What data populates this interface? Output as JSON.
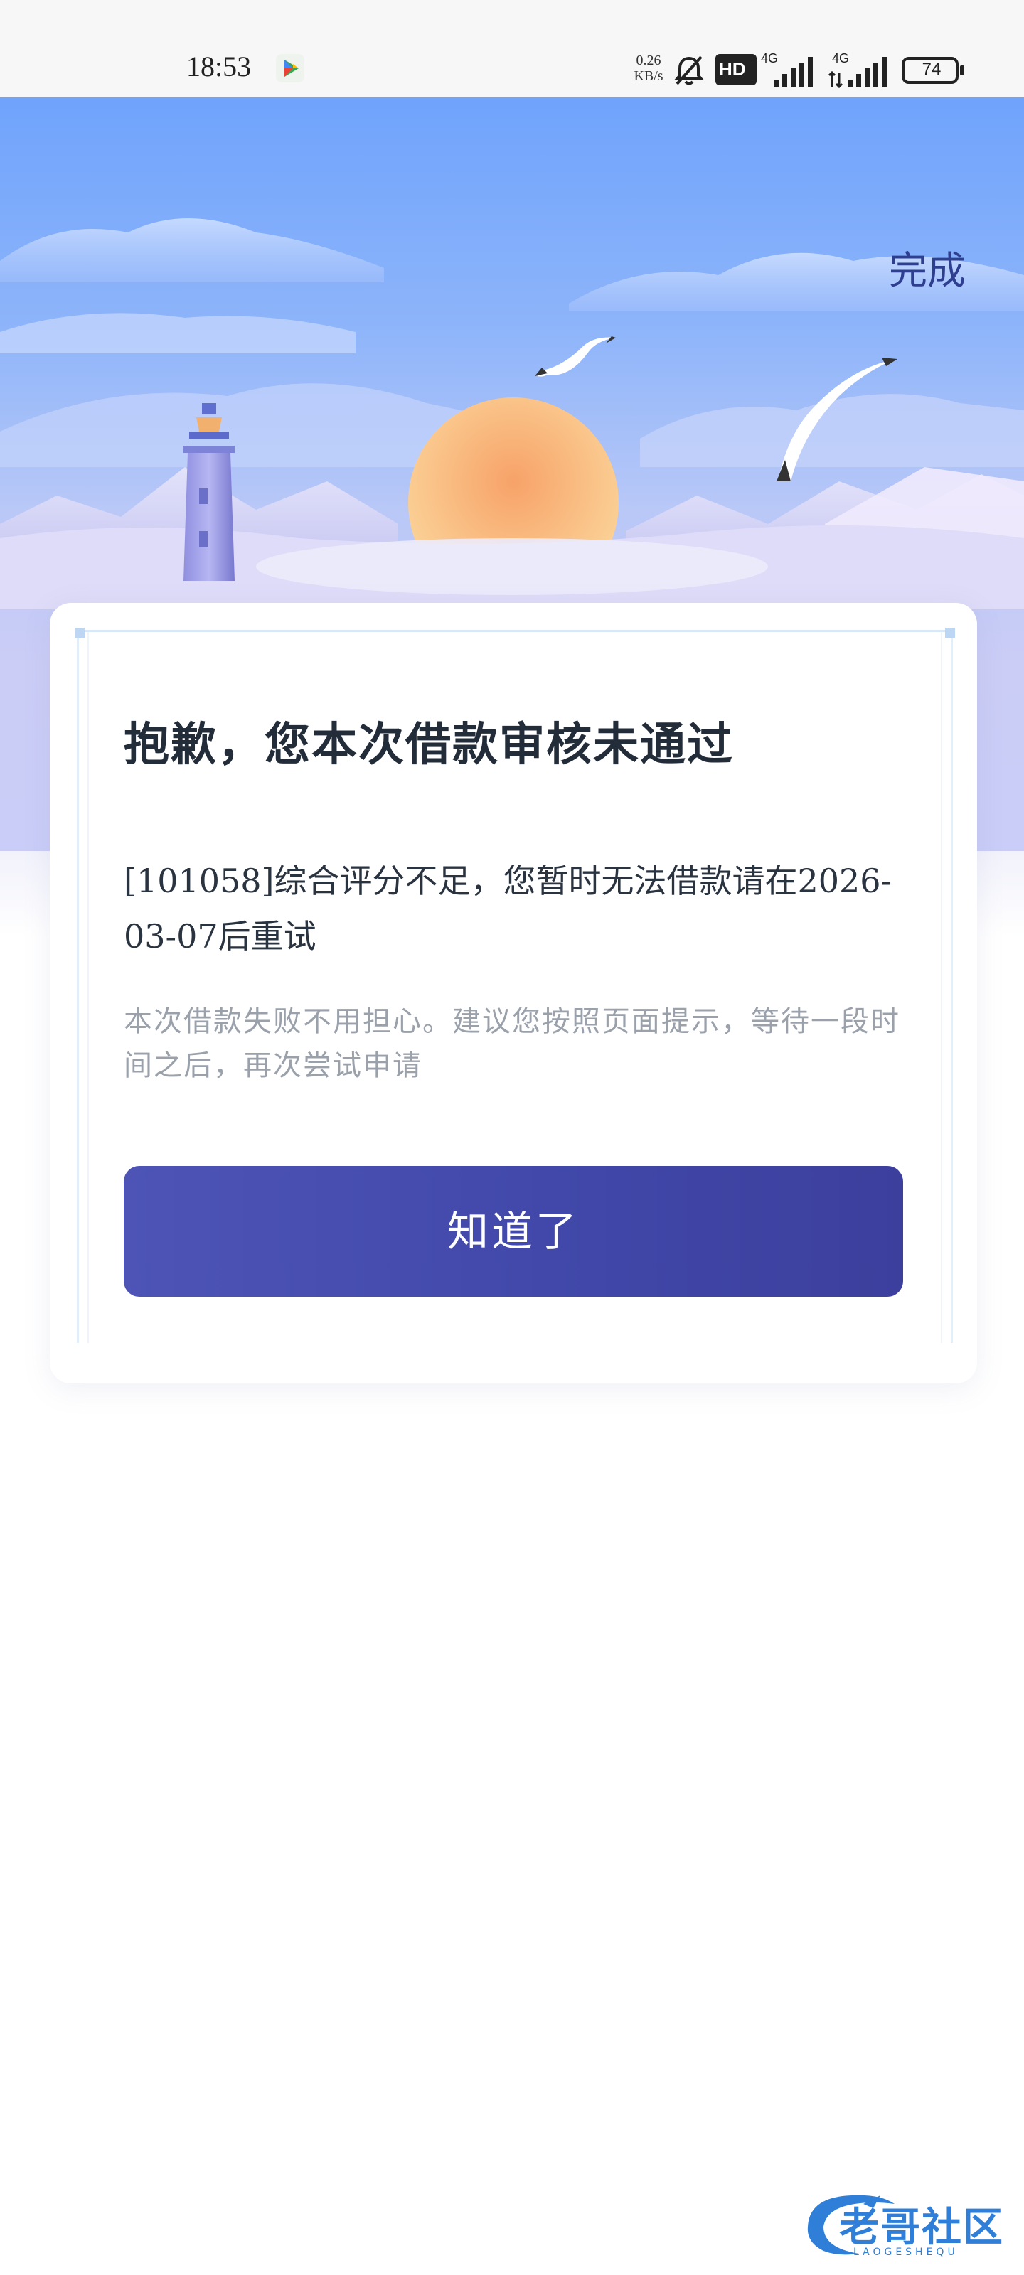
{
  "status_bar": {
    "time": "18:53",
    "net_speed_value": "0.26",
    "net_speed_unit": "KB/s",
    "hd_label": "HD",
    "signal_1_label": "4G",
    "signal_2_label": "4G",
    "battery": "74",
    "icons": [
      "play-store-icon",
      "mute-bell-icon",
      "hd-icon",
      "signal-icon",
      "signal-icon",
      "battery-icon"
    ]
  },
  "header": {
    "done_label": "完成"
  },
  "card": {
    "title": "抱歉，您本次借款审核未通过",
    "reason": "[101058]综合评分不足，您暂时无法借款请在2026-03-07后重试",
    "tip": "本次借款失败不用担心。建议您按照页面提示，等待一段时间之后，再次尝试申请",
    "button_label": "知道了"
  },
  "watermark": {
    "text": "老哥社区",
    "subtext": "LAOGESHEQU"
  },
  "colors": {
    "sky_top": "#6fa3fc",
    "button": "#4047a8",
    "done": "#2f3f8f",
    "sun": "#f6b57e"
  }
}
